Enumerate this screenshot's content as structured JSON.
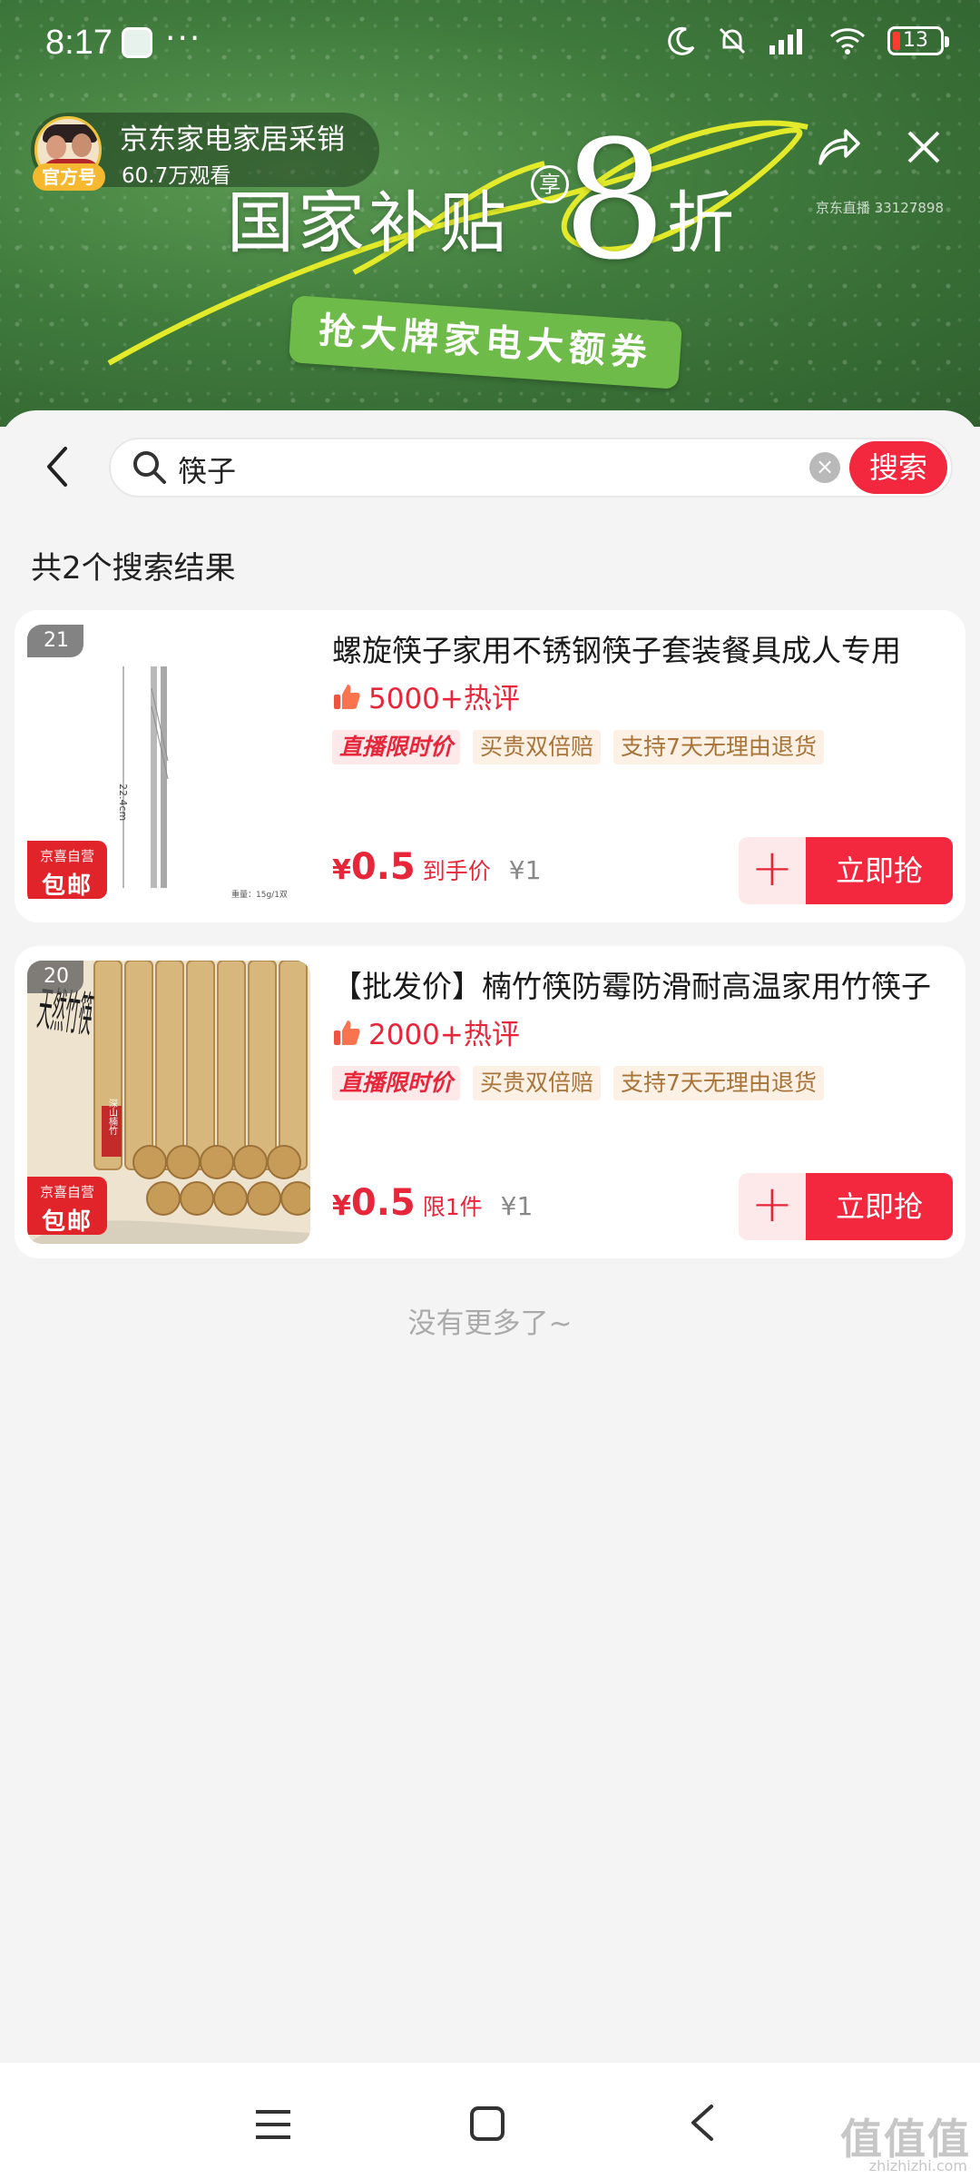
{
  "status_bar": {
    "time": "8:17",
    "dots": "···",
    "battery": "13"
  },
  "live_header": {
    "badge": "官方号",
    "name": "京东家电家居采销",
    "viewers": "60.7万观看",
    "room_id": "京东直播 33127898"
  },
  "banner_ad": {
    "title": "国家补贴",
    "xiang": "享",
    "eight": "8",
    "zhe": "折",
    "ribbon": "抢大牌家电大额券",
    "colors": {
      "background": "#3f7a3c",
      "ribbon": "#6fbb49",
      "swoosh": "#e2ea2a"
    }
  },
  "search": {
    "query": "筷子",
    "button": "搜索"
  },
  "results": {
    "count_text": "共2个搜索结果",
    "items": [
      {
        "rank": "21",
        "ship_line1": "京喜自营",
        "ship_line2": "包邮",
        "title": "螺旋筷子家用不锈钢筷子套装餐具成人专用",
        "reviews": "5000+热评",
        "tags": [
          "直播限时价",
          "买贵双倍赔",
          "支持7天无理由退货"
        ],
        "currency": "¥",
        "price": "0.5",
        "price_note": "到手价",
        "original_price": "¥1",
        "buy_label": "立即抢",
        "thumb_size_label": "22.4cm",
        "thumb_weight_label": "重量：15g/1双"
      },
      {
        "rank": "20",
        "ship_line1": "京喜自营",
        "ship_line2": "包邮",
        "title": "【批发价】楠竹筷防霉防滑耐高温家用竹筷子",
        "reviews": "2000+热评",
        "tags": [
          "直播限时价",
          "买贵双倍赔",
          "支持7天无理由退货"
        ],
        "currency": "¥",
        "price": "0.5",
        "price_note": "限1件",
        "original_price": "¥1",
        "buy_label": "立即抢",
        "thumb_art_text": "天然竹筷",
        "thumb_stamp": "深山楠竹"
      }
    ],
    "end_text": "没有更多了~"
  },
  "watermark": {
    "main": "值值值",
    "sub": "zhizhizhi.com"
  },
  "accent_color": "#f3273d"
}
